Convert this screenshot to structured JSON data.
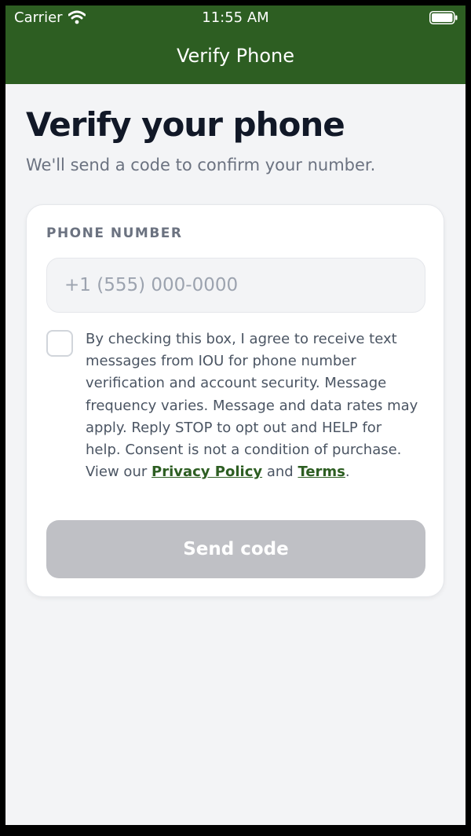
{
  "status_bar": {
    "carrier": "Carrier",
    "time": "11:55 AM"
  },
  "nav": {
    "title": "Verify Phone"
  },
  "page": {
    "title": "Verify your phone",
    "subtitle": "We'll send a code to confirm your number."
  },
  "form": {
    "phone_label": "PHONE NUMBER",
    "phone_placeholder": "+1 (555) 000-0000",
    "phone_value": "",
    "consent_checked": false,
    "consent_text": "By checking this box, I agree to receive text messages from IOU for phone number verification and account security. Message frequency varies. Message and data rates may apply. Reply STOP to opt out and HELP for help. Consent is not a condition of purchase. View our",
    "privacy_link": "Privacy Policy",
    "and_text": "and",
    "terms_link": "Terms",
    "period": ".",
    "send_button": "Send code"
  },
  "icons": {
    "wifi": "wifi-icon",
    "battery": "battery-icon"
  },
  "colors": {
    "header_bg": "#2d5e22",
    "link": "#2d5e22",
    "button_disabled": "#bfc0c5",
    "page_bg": "#f3f4f6"
  }
}
